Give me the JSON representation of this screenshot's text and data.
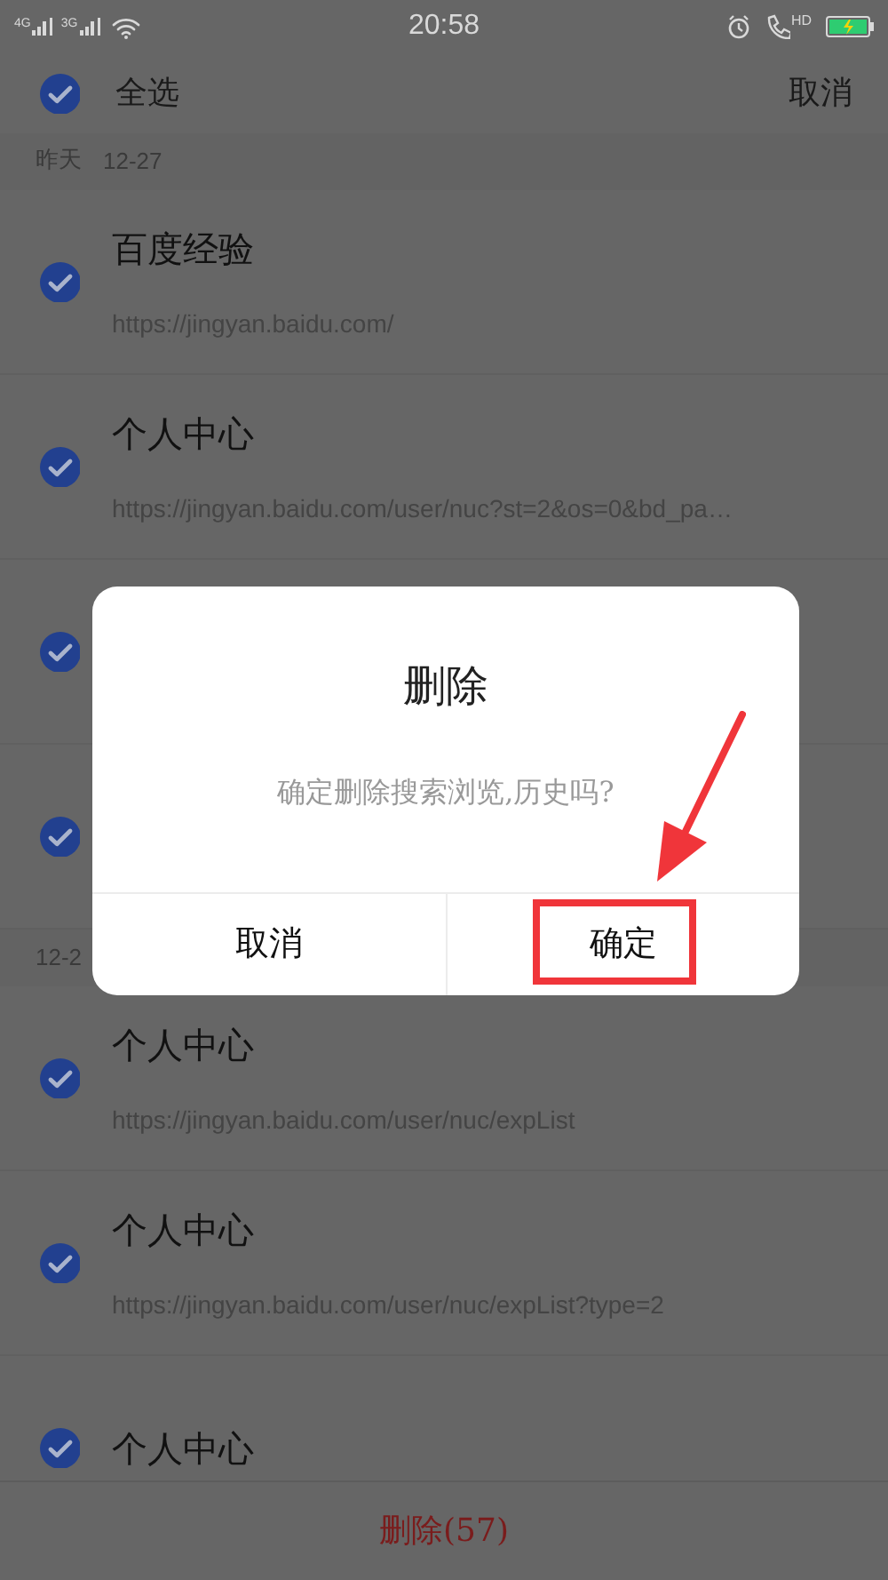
{
  "status_bar": {
    "networks": [
      "4G",
      "3G"
    ],
    "time": "20:58",
    "call_label": "HD",
    "battery_charging": true
  },
  "header": {
    "select_all": {
      "label": "全选",
      "checked": true
    },
    "cancel": "取消"
  },
  "sections": [
    {
      "day": "昨天",
      "date": "12-27",
      "items": [
        {
          "title": "百度经验",
          "url": "https://jingyan.baidu.com/",
          "checked": true
        },
        {
          "title": "个人中心",
          "url": "https://jingyan.baidu.com/user/nuc?st=2&os=0&bd_pa…",
          "checked": true
        },
        {
          "checked": true
        },
        {
          "checked": true
        }
      ]
    },
    {
      "date": "12-2",
      "items": [
        {
          "title": "个人中心",
          "url": "https://jingyan.baidu.com/user/nuc/expList",
          "checked": true
        },
        {
          "title": "个人中心",
          "url": "https://jingyan.baidu.com/user/nuc/expList?type=2",
          "checked": true
        },
        {
          "title": "个人中心",
          "checked": true
        }
      ]
    }
  ],
  "bottom_bar": {
    "delete": "删除(57)"
  },
  "dialog": {
    "title": "删除",
    "message": "确定删除搜索浏览,历史吗?",
    "buttons": [
      {
        "label": "取消",
        "highlighted": false
      },
      {
        "label": "确定",
        "highlighted": true
      }
    ]
  }
}
